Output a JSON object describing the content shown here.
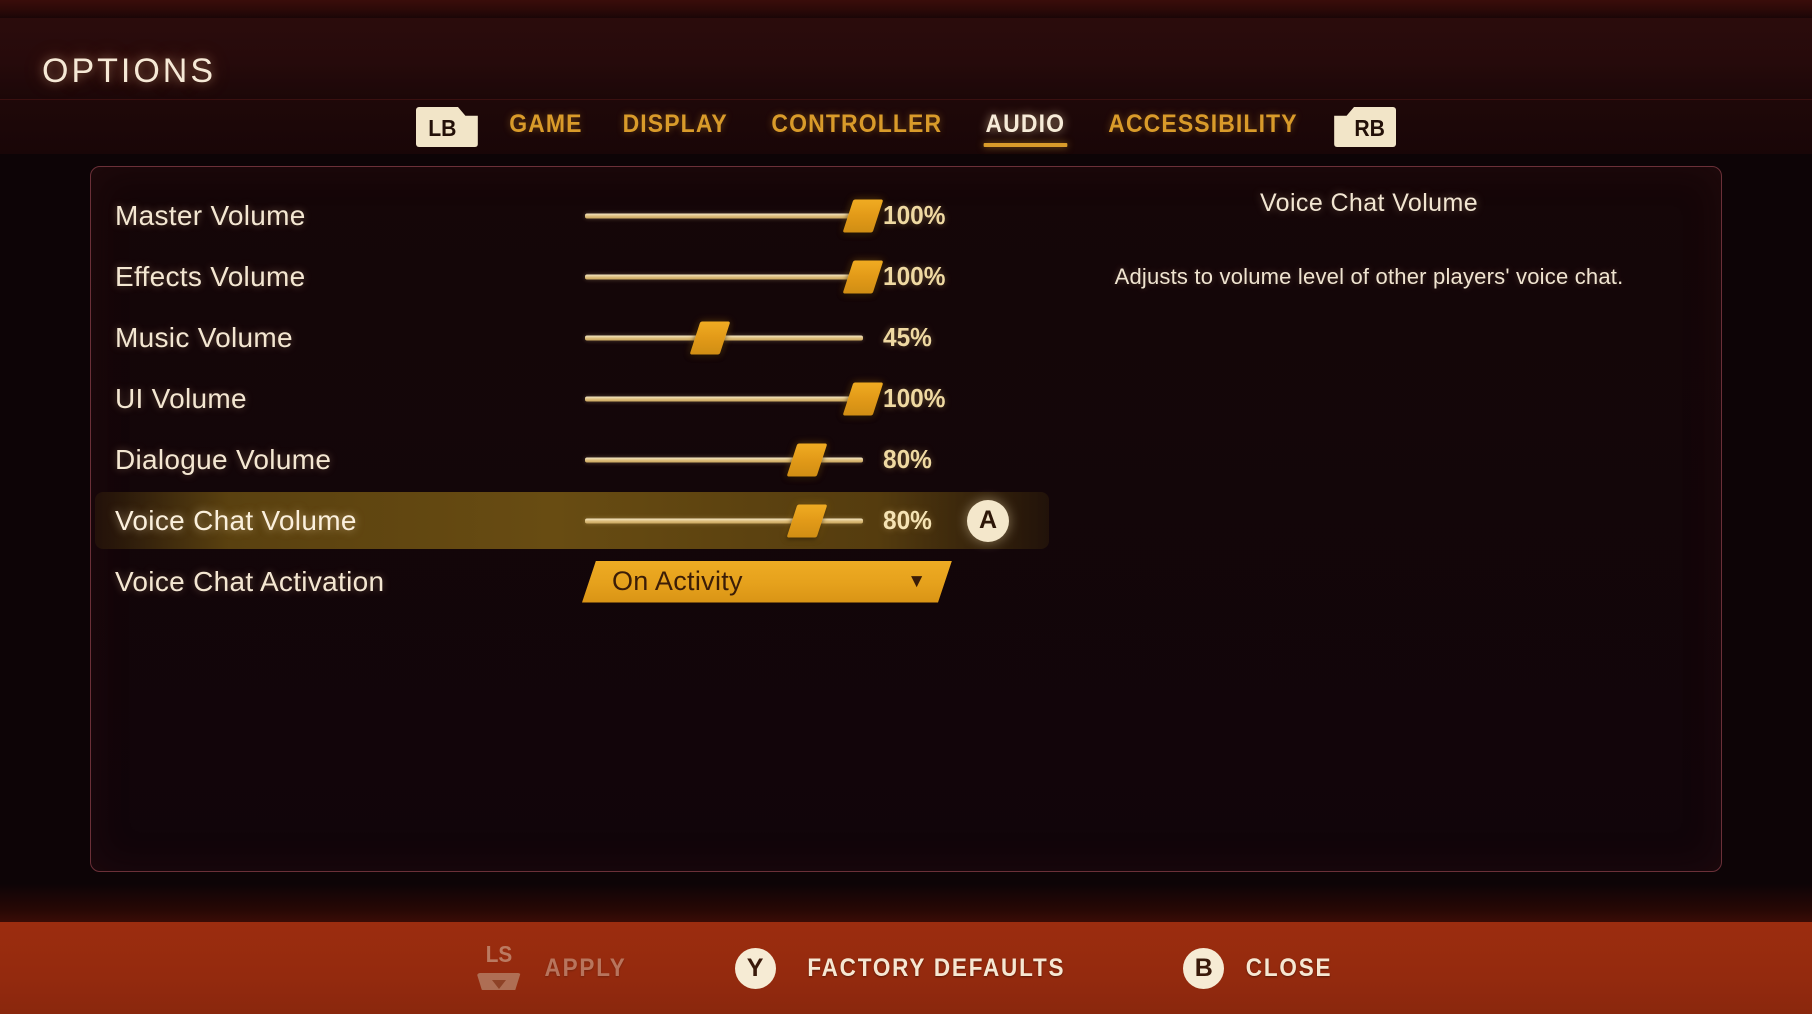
{
  "header": {
    "title": "OPTIONS"
  },
  "tabs": {
    "prev_bumper": "LB",
    "next_bumper": "RB",
    "items": [
      {
        "label": "GAME",
        "active": false
      },
      {
        "label": "DISPLAY",
        "active": false
      },
      {
        "label": "CONTROLLER",
        "active": false
      },
      {
        "label": "AUDIO",
        "active": true
      },
      {
        "label": "ACCESSIBILITY",
        "active": false
      }
    ]
  },
  "settings": {
    "rows": [
      {
        "label": "Master Volume",
        "type": "slider",
        "value": 100,
        "display": "100%",
        "selected": false
      },
      {
        "label": "Effects Volume",
        "type": "slider",
        "value": 100,
        "display": "100%",
        "selected": false
      },
      {
        "label": "Music Volume",
        "type": "slider",
        "value": 45,
        "display": "45%",
        "selected": false
      },
      {
        "label": "UI Volume",
        "type": "slider",
        "value": 100,
        "display": "100%",
        "selected": false
      },
      {
        "label": "Dialogue Volume",
        "type": "slider",
        "value": 80,
        "display": "80%",
        "selected": false
      },
      {
        "label": "Voice Chat Volume",
        "type": "slider",
        "value": 80,
        "display": "80%",
        "selected": true,
        "action_button": "A"
      },
      {
        "label": "Voice Chat Activation",
        "type": "dropdown",
        "value": "On Activity",
        "arrow": "▼",
        "selected": false
      }
    ]
  },
  "description": {
    "title": "Voice Chat Volume",
    "body": "Adjusts to volume level of other players' voice chat."
  },
  "footer": {
    "actions": [
      {
        "icon": "left-stick",
        "glyph": "LS",
        "label": "APPLY",
        "dimmed": true
      },
      {
        "icon": "button-y",
        "glyph": "Y",
        "label": "FACTORY DEFAULTS",
        "dimmed": false
      },
      {
        "icon": "button-b",
        "glyph": "B",
        "label": "CLOSE",
        "dimmed": false
      }
    ]
  },
  "colors": {
    "accent_gold": "#e5a11c",
    "text_cream": "#f4e7d2",
    "tab_gold": "#d99b2a",
    "footer_red": "#942a0e",
    "panel_border": "#6b3038",
    "selected_row": "#68520f"
  }
}
